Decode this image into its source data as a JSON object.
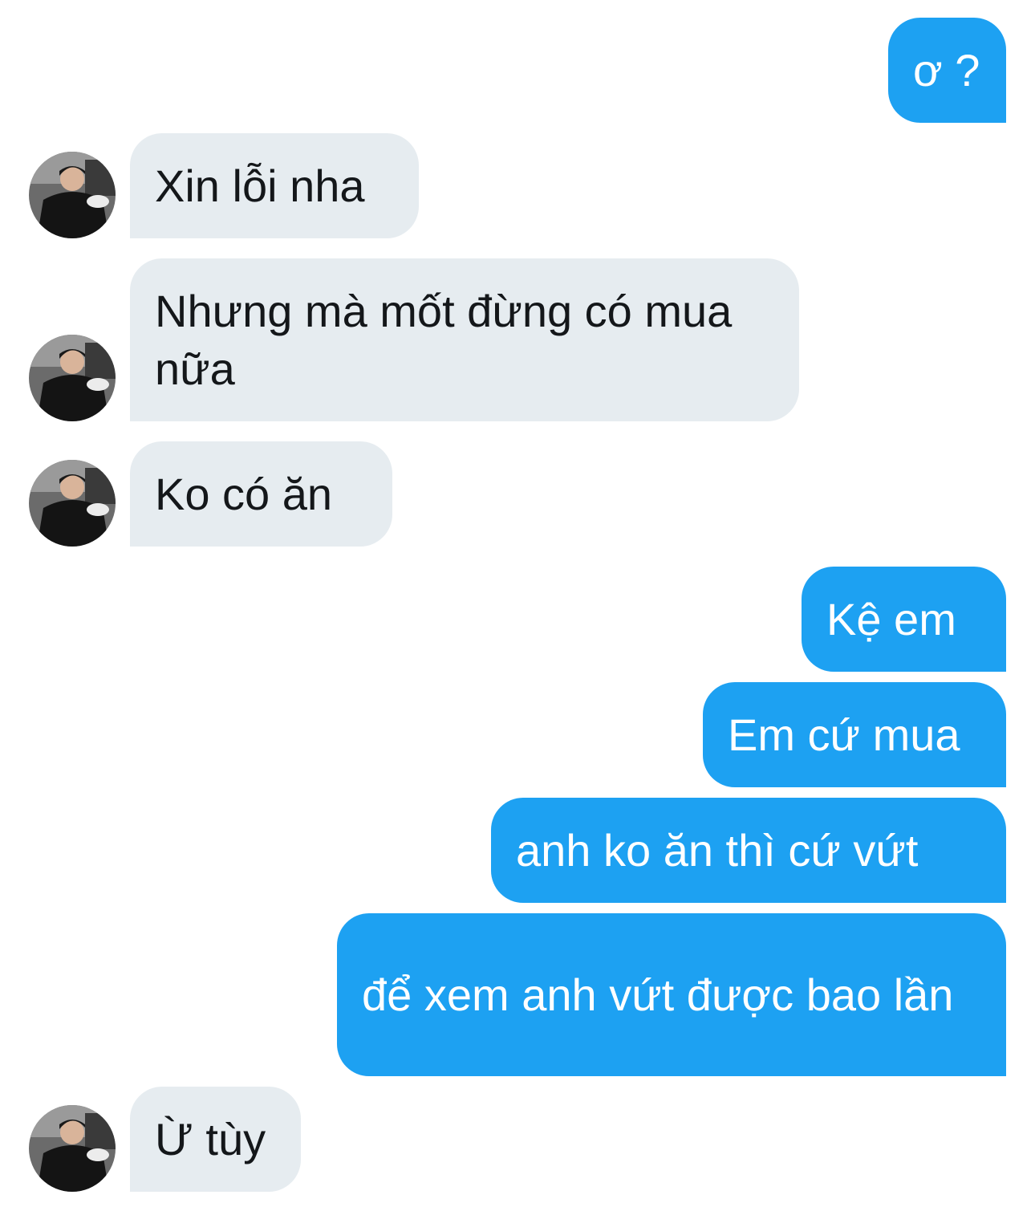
{
  "conversation": {
    "messages": [
      {
        "direction": "sent",
        "text": "ơ ?"
      },
      {
        "direction": "received",
        "text": "Xin lỗi nha"
      },
      {
        "direction": "received",
        "text": "Nhưng mà mốt đừng có mua nữa"
      },
      {
        "direction": "received",
        "text": "Ko có ăn"
      },
      {
        "direction": "sent",
        "text": "Kệ em"
      },
      {
        "direction": "sent",
        "text": "Em cứ mua"
      },
      {
        "direction": "sent",
        "text": "anh ko ăn thì cứ vứt"
      },
      {
        "direction": "sent",
        "text": "để xem anh vứt được bao lần"
      },
      {
        "direction": "received",
        "text": "Ừ tùy"
      }
    ]
  },
  "colors": {
    "sent_bubble": "#1da1f2",
    "received_bubble": "#e6ecf0",
    "sent_text": "#ffffff",
    "received_text": "#14171a"
  },
  "icons": {
    "avatar": "user-avatar-photo"
  }
}
